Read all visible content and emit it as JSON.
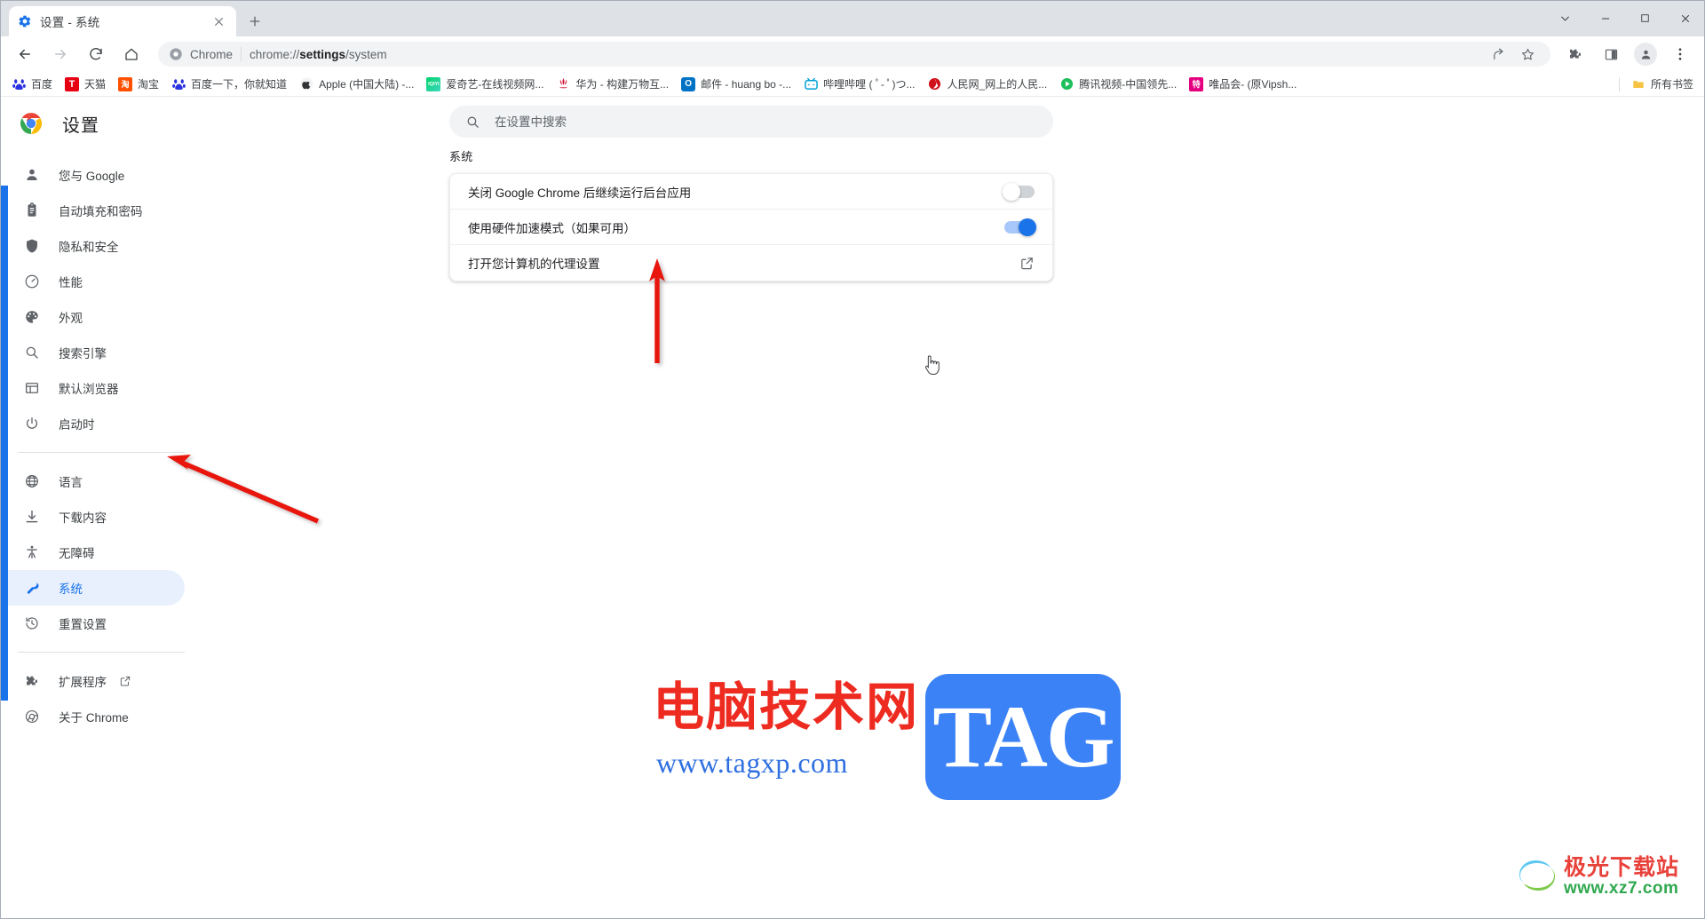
{
  "window": {
    "controls": [
      {
        "name": "tab-search-chevron",
        "glyph": "⌄"
      },
      {
        "name": "minimize",
        "glyph": "—"
      },
      {
        "name": "maximize",
        "glyph": "□"
      },
      {
        "name": "close",
        "glyph": "✕"
      }
    ]
  },
  "tab": {
    "title": "设置 - 系统",
    "favicon": "gear-icon",
    "close_label": "✕",
    "newtab_label": "+"
  },
  "toolbar": {
    "back": "←",
    "forward": "→",
    "reload": "⟳",
    "home": "⌂",
    "omnibox": {
      "chip_label": "Chrome",
      "url_prefix": "chrome://",
      "url_bold": "settings",
      "url_suffix": "/system"
    },
    "share_icon": "share-icon",
    "bookmark_icon": "star-icon",
    "extensions_icon": "puzzle-icon",
    "sidepanel_icon": "side-panel-icon",
    "profile_icon": "avatar-icon",
    "menu_icon": "three-dots-icon"
  },
  "bookmarks": {
    "items": [
      {
        "label": "百度",
        "icon_text": "",
        "icon_bg": "#ffffff",
        "icon_fg": "#2932e1",
        "kind": "baidu"
      },
      {
        "label": "天猫",
        "icon_text": "T",
        "icon_bg": "#e60012",
        "icon_fg": "#ffffff",
        "kind": "tmall"
      },
      {
        "label": "淘宝",
        "icon_text": "淘",
        "icon_bg": "#ff5000",
        "icon_fg": "#ffffff",
        "kind": "taobao"
      },
      {
        "label": "百度一下，你就知道",
        "icon_text": "",
        "icon_bg": "#ffffff",
        "icon_fg": "#2932e1",
        "kind": "baidu"
      },
      {
        "label": "Apple (中国大陆) -...",
        "icon_text": "",
        "icon_bg": "#ffffff",
        "icon_fg": "#333333",
        "kind": "apple"
      },
      {
        "label": "爱奇艺-在线视频网...",
        "icon_text": "iQIYI",
        "icon_bg": "#00be06",
        "icon_fg": "#ffffff",
        "kind": "iqiyi"
      },
      {
        "label": "华为 - 构建万物互...",
        "icon_text": "",
        "icon_bg": "#ffffff",
        "icon_fg": "#cf0a2c",
        "kind": "huawei"
      },
      {
        "label": "邮件 - huang bo -...",
        "icon_text": "O",
        "icon_bg": "#0072c6",
        "icon_fg": "#ffffff",
        "kind": "outlook"
      },
      {
        "label": "哔哩哔哩 ( ﾟ- ﾟ)つ...",
        "icon_text": "",
        "icon_bg": "#ffffff",
        "icon_fg": "#00a1d6",
        "kind": "bilibili"
      },
      {
        "label": "人民网_网上的人民...",
        "icon_text": "",
        "icon_bg": "#ffffff",
        "icon_fg": "#d0111b",
        "kind": "people"
      },
      {
        "label": "腾讯视频-中国领先...",
        "icon_text": "",
        "icon_bg": "#ffffff",
        "icon_fg": "#1dbf5c",
        "kind": "tencent"
      },
      {
        "label": "唯品会- (原Vipsh...",
        "icon_text": "特",
        "icon_bg": "#e4007f",
        "icon_fg": "#ffffff",
        "kind": "vip"
      }
    ],
    "all_bookmarks_label": "所有书签",
    "all_bookmarks_icon": "folder-icon"
  },
  "sidebar": {
    "brand": "设置",
    "brand_icon": "chrome-logo",
    "group_one": [
      {
        "label": "您与 Google",
        "icon": "person-icon",
        "active": false
      },
      {
        "label": "自动填充和密码",
        "icon": "clipboard-icon",
        "active": false
      },
      {
        "label": "隐私和安全",
        "icon": "shield-icon",
        "active": false
      },
      {
        "label": "性能",
        "icon": "speedometer-icon",
        "active": false
      },
      {
        "label": "外观",
        "icon": "palette-icon",
        "active": false
      },
      {
        "label": "搜索引擎",
        "icon": "search-icon",
        "active": false
      },
      {
        "label": "默认浏览器",
        "icon": "browser-icon",
        "active": false
      },
      {
        "label": "启动时",
        "icon": "power-icon",
        "active": false
      }
    ],
    "group_two": [
      {
        "label": "语言",
        "icon": "globe-icon",
        "active": false
      },
      {
        "label": "下载内容",
        "icon": "download-icon",
        "active": false
      },
      {
        "label": "无障碍",
        "icon": "accessibility-icon",
        "active": false
      },
      {
        "label": "系统",
        "icon": "wrench-icon",
        "active": true
      },
      {
        "label": "重置设置",
        "icon": "history-icon",
        "active": false
      }
    ],
    "group_three": [
      {
        "label": "扩展程序",
        "icon": "puzzle-icon",
        "active": false,
        "external": true
      },
      {
        "label": "关于 Chrome",
        "icon": "chrome-icon",
        "active": false,
        "external": false
      }
    ]
  },
  "main": {
    "search_placeholder": "在设置中搜索",
    "search_value": "",
    "search_icon": "search-icon",
    "section_title": "系统",
    "rows": [
      {
        "label": "关闭 Google Chrome 后继续运行后台应用",
        "control": "toggle",
        "state": "off"
      },
      {
        "label": "使用硬件加速模式（如果可用）",
        "control": "toggle",
        "state": "on"
      },
      {
        "label": "打开您计算机的代理设置",
        "control": "external-link",
        "state": ""
      }
    ]
  },
  "annotations": {
    "arrow_to_proxy_row": "arrow-up-to-proxy-setting",
    "arrow_to_system_nav": "arrow-up-left-to-system-nav",
    "arrow_color": "#e8180c"
  },
  "watermarks": {
    "site_cn": "电脑技术网",
    "site_url": "www.tagxp.com",
    "tag_badge": "TAG",
    "corner_cn": "极光下载站",
    "corner_url": "www.xz7.com"
  },
  "colors": {
    "accent": "#1a73e8",
    "active_bg": "#e8f0fe",
    "toolbar_bg": "#ffffff",
    "tabstrip_bg": "#dee1e6",
    "search_bg": "#f1f3f4",
    "arrow_red": "#e8180c",
    "watermark_red": "#ee2b20",
    "watermark_blue": "#3b82f6"
  }
}
